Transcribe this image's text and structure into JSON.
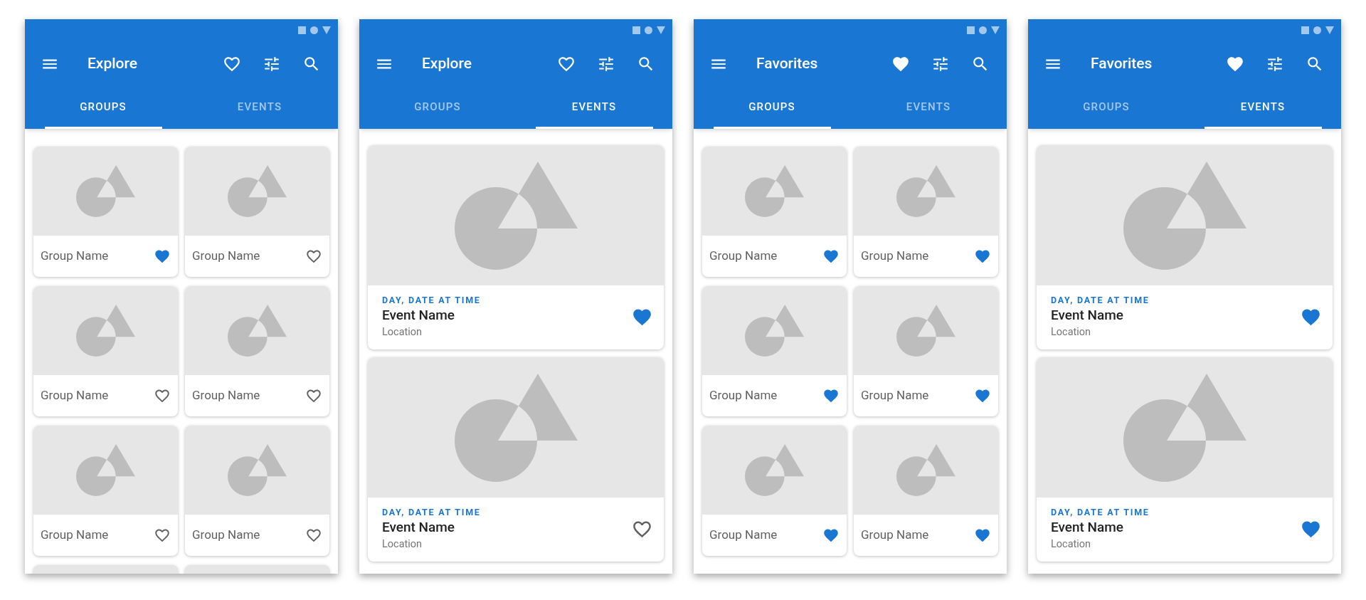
{
  "screens": [
    {
      "title": "Explore",
      "favorites_filter": false,
      "tabs": [
        {
          "label": "GROUPS",
          "selected": true
        },
        {
          "label": "EVENTS",
          "selected": false
        }
      ],
      "cards": [
        {
          "kind": "group",
          "name": "Group Name",
          "favorite": true
        },
        {
          "kind": "group",
          "name": "Group Name",
          "favorite": false
        },
        {
          "kind": "group",
          "name": "Group Name",
          "favorite": false
        },
        {
          "kind": "group",
          "name": "Group Name",
          "favorite": false
        },
        {
          "kind": "group",
          "name": "Group Name",
          "favorite": false
        },
        {
          "kind": "group",
          "name": "Group Name",
          "favorite": false
        },
        {
          "kind": "cut"
        },
        {
          "kind": "cut"
        }
      ]
    },
    {
      "title": "Explore",
      "favorites_filter": false,
      "tabs": [
        {
          "label": "GROUPS",
          "selected": false
        },
        {
          "label": "EVENTS",
          "selected": true
        }
      ],
      "cards": [
        {
          "kind": "event",
          "date": "DAY, DATE AT TIME",
          "name": "Event Name",
          "location": "Location",
          "favorite": true
        },
        {
          "kind": "event",
          "date": "DAY, DATE AT TIME",
          "name": "Event Name",
          "location": "Location",
          "favorite": false
        }
      ]
    },
    {
      "title": "Favorites",
      "favorites_filter": true,
      "tabs": [
        {
          "label": "GROUPS",
          "selected": true
        },
        {
          "label": "EVENTS",
          "selected": false
        }
      ],
      "cards": [
        {
          "kind": "group",
          "name": "Group Name",
          "favorite": true
        },
        {
          "kind": "group",
          "name": "Group Name",
          "favorite": true
        },
        {
          "kind": "group",
          "name": "Group Name",
          "favorite": true
        },
        {
          "kind": "group",
          "name": "Group Name",
          "favorite": true
        },
        {
          "kind": "group",
          "name": "Group Name",
          "favorite": true
        },
        {
          "kind": "group",
          "name": "Group Name",
          "favorite": true
        }
      ]
    },
    {
      "title": "Favorites",
      "favorites_filter": true,
      "tabs": [
        {
          "label": "GROUPS",
          "selected": false
        },
        {
          "label": "EVENTS",
          "selected": true
        }
      ],
      "cards": [
        {
          "kind": "event",
          "date": "DAY, DATE AT TIME",
          "name": "Event Name",
          "location": "Location",
          "favorite": true
        },
        {
          "kind": "event",
          "date": "DAY, DATE AT TIME",
          "name": "Event Name",
          "location": "Location",
          "favorite": true
        }
      ]
    }
  ]
}
